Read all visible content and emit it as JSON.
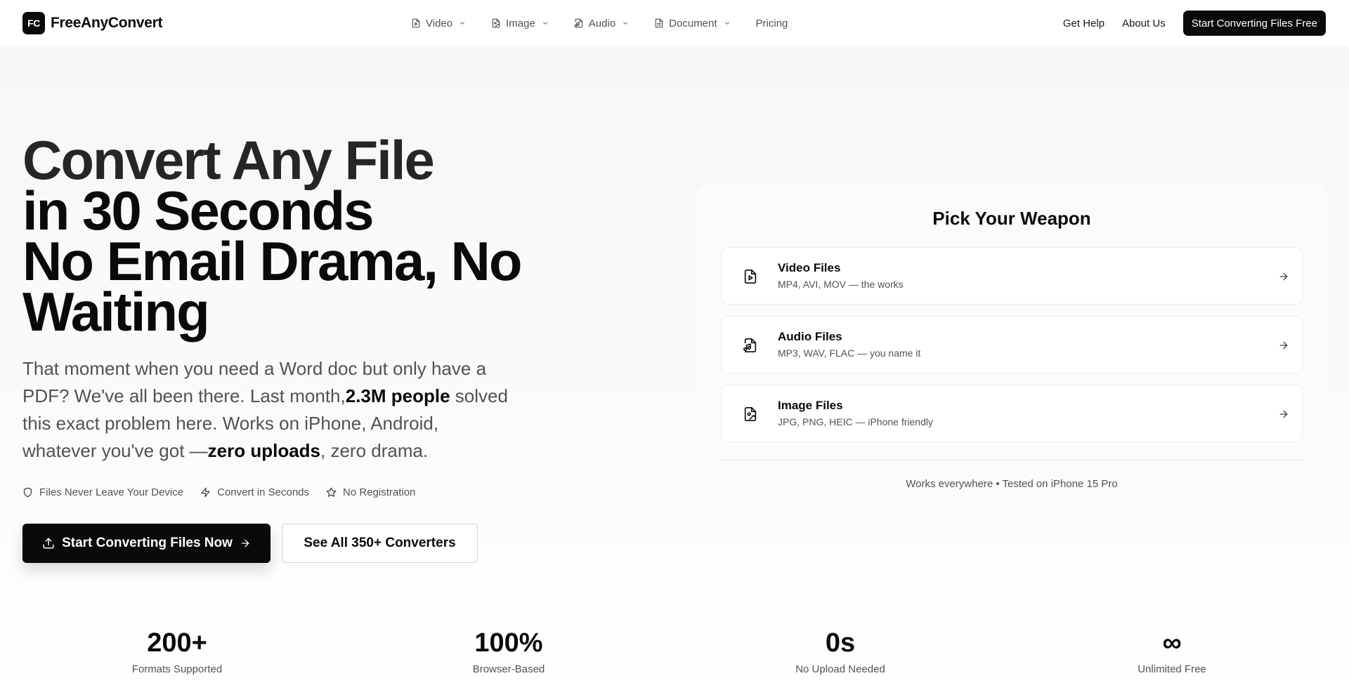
{
  "brand": {
    "badge": "FC",
    "name": "FreeAnyConvert"
  },
  "nav": {
    "items": [
      {
        "label": "Video",
        "icon": "file-video-icon",
        "dropdown": true
      },
      {
        "label": "Image",
        "icon": "file-image-icon",
        "dropdown": true
      },
      {
        "label": "Audio",
        "icon": "file-audio-icon",
        "dropdown": true
      },
      {
        "label": "Document",
        "icon": "file-text-icon",
        "dropdown": true
      },
      {
        "label": "Pricing",
        "dropdown": false
      }
    ],
    "get_help": "Get Help",
    "about": "About Us",
    "cta": "Start Converting Files Free"
  },
  "hero": {
    "title_lines": [
      "Convert Any File",
      "in 30 Seconds",
      "No Email Drama, No",
      "Waiting"
    ],
    "desc_part1": "That moment when you need a Word doc but only have a PDF? We've all been there. Last month,",
    "desc_bold1": "2.3M people",
    "desc_part2": " solved this exact problem here. Works on iPhone, Android, whatever you've got —",
    "desc_bold2": "zero uploads",
    "desc_part3": ", zero drama.",
    "features": [
      {
        "label": "Files Never Leave Your Device",
        "icon": "shield-icon"
      },
      {
        "label": "Convert in Seconds",
        "icon": "zap-icon"
      },
      {
        "label": "No Registration",
        "icon": "star-icon"
      }
    ],
    "cta_primary": "Start Converting Files Now",
    "cta_secondary": "See All 350+ Converters"
  },
  "picker": {
    "title": "Pick Your Weapon",
    "options": [
      {
        "name": "Video Files",
        "desc": "MP4, AVI, MOV — the works",
        "icon": "file-video-icon"
      },
      {
        "name": "Audio Files",
        "desc": "MP3, WAV, FLAC — you name it",
        "icon": "file-audio-icon"
      },
      {
        "name": "Image Files",
        "desc": "JPG, PNG, HEIC — iPhone friendly",
        "icon": "file-image-icon"
      }
    ],
    "footer": "Works everywhere • Tested on iPhone 15 Pro"
  },
  "stats": [
    {
      "value": "200+",
      "label": "Formats Supported"
    },
    {
      "value": "100%",
      "label": "Browser-Based"
    },
    {
      "value": "0s",
      "label": "No Upload Needed"
    },
    {
      "value": "∞",
      "label": "Unlimited Free"
    }
  ],
  "colors": {
    "primary": "#0a0a0a",
    "muted_text": "#525252",
    "background_tint": "#f7f7f8"
  }
}
